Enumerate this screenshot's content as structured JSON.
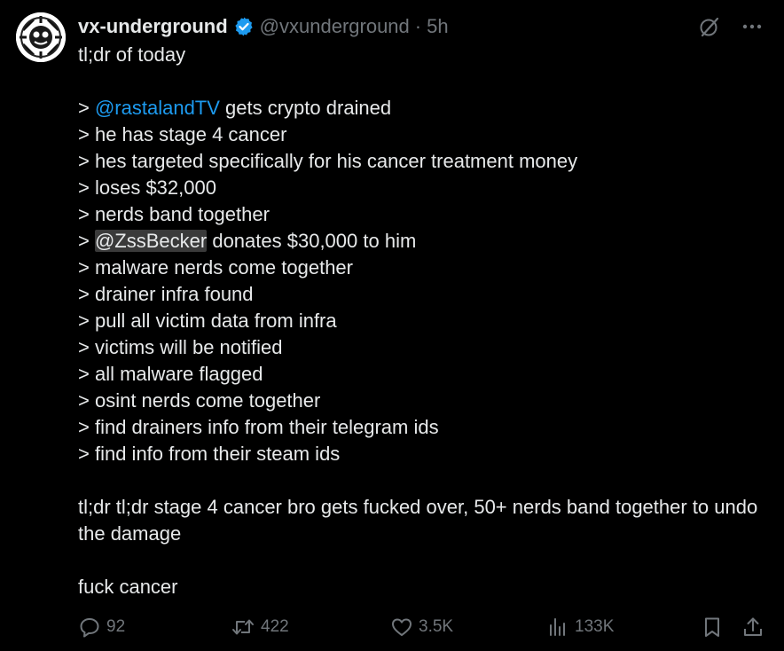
{
  "author": {
    "display_name": "vx-underground",
    "handle": "@vxunderground",
    "separator": "·",
    "time": "5h",
    "verified": true
  },
  "colors": {
    "background": "#000000",
    "text": "#e7e9ea",
    "muted": "#71767b",
    "link": "#1d9bf0",
    "verified": "#1d9bf0"
  },
  "icons": {
    "grok": "grok-icon",
    "more": "more-icon",
    "reply": "reply-icon",
    "retweet": "retweet-icon",
    "like": "like-icon",
    "views": "views-icon",
    "bookmark": "bookmark-icon",
    "share": "share-icon"
  },
  "tweet": {
    "intro": "tl;dr of today",
    "lines": [
      {
        "prefix": "> ",
        "mention": "@rastalandTV",
        "text": " gets crypto drained"
      },
      {
        "prefix": "> ",
        "text": "he has stage 4 cancer"
      },
      {
        "prefix": "> ",
        "text": "hes targeted specifically for his cancer treatment money"
      },
      {
        "prefix": "> ",
        "text": "loses $32,000"
      },
      {
        "prefix": "> ",
        "text": "nerds band together"
      },
      {
        "prefix": "> ",
        "mention": "@ZssBecker",
        "text": " donates $30,000 to him"
      },
      {
        "prefix": "> ",
        "text": "malware nerds come together"
      },
      {
        "prefix": "> ",
        "text": "drainer infra found"
      },
      {
        "prefix": "> ",
        "text": "pull all victim data from infra"
      },
      {
        "prefix": "> ",
        "text": "victims will be notified"
      },
      {
        "prefix": "> ",
        "text": "all malware flagged"
      },
      {
        "prefix": "> ",
        "text": "osint nerds come together"
      },
      {
        "prefix": "> ",
        "text": "find drainers info from their telegram ids"
      },
      {
        "prefix": "> ",
        "text": "find info from their steam ids"
      }
    ],
    "summary": "tl;dr tl;dr stage 4 cancer bro gets fucked over, 50+ nerds band together to undo the damage",
    "closing": "fuck cancer"
  },
  "stats": {
    "replies": "92",
    "retweets": "422",
    "likes": "3.5K",
    "views": "133K"
  }
}
